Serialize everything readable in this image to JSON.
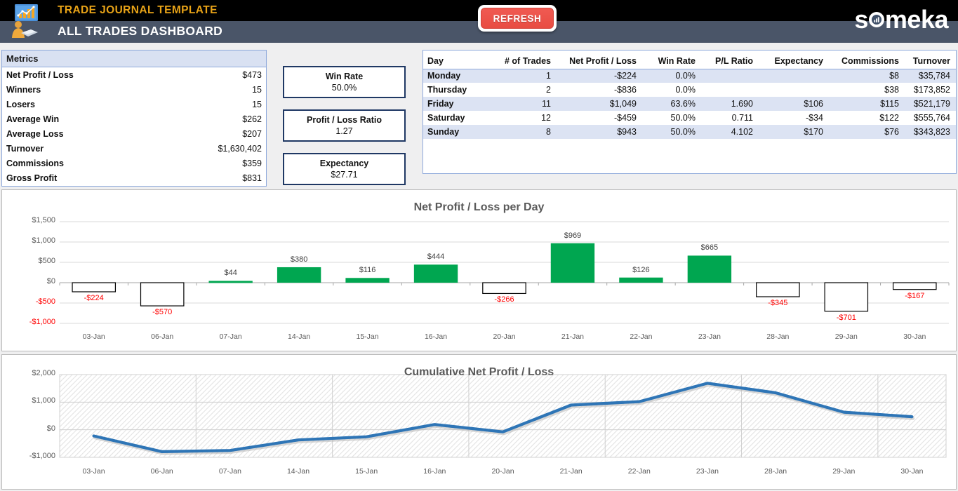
{
  "header": {
    "template_title": "TRADE JOURNAL TEMPLATE",
    "dashboard_title": "ALL TRADES DASHBOARD",
    "refresh_label": "REFRESH",
    "brand": "someka",
    "logo_icon": "trader-chart-icon"
  },
  "metrics": {
    "title": "Metrics",
    "rows": [
      {
        "label": "Net Profit / Loss",
        "value": "$473"
      },
      {
        "label": "Winners",
        "value": "15"
      },
      {
        "label": "Losers",
        "value": "15"
      },
      {
        "label": "Average Win",
        "value": "$262"
      },
      {
        "label": "Average Loss",
        "value": "$207"
      },
      {
        "label": "Turnover",
        "value": "$1,630,402"
      },
      {
        "label": "Commissions",
        "value": "$359"
      },
      {
        "label": "Gross Profit",
        "value": "$831"
      }
    ]
  },
  "kpis": [
    {
      "label": "Win Rate",
      "value": "50.0%"
    },
    {
      "label": "Profit / Loss Ratio",
      "value": "1.27"
    },
    {
      "label": "Expectancy",
      "value": "$27.71"
    }
  ],
  "day_table": {
    "columns": [
      "Day",
      "# of Trades",
      "Net Profit / Loss",
      "Win Rate",
      "P/L Ratio",
      "Expectancy",
      "Commissions",
      "Turnover"
    ],
    "rows": [
      {
        "day": "Monday",
        "trades": "1",
        "net": "-$224",
        "net_negative": true,
        "win_rate": "0.0%",
        "pl_ratio": "",
        "expectancy": "",
        "commissions": "$8",
        "turnover": "$35,784"
      },
      {
        "day": "Thursday",
        "trades": "2",
        "net": "-$836",
        "net_negative": true,
        "win_rate": "0.0%",
        "pl_ratio": "",
        "expectancy": "",
        "commissions": "$38",
        "turnover": "$173,852"
      },
      {
        "day": "Friday",
        "trades": "11",
        "net": "$1,049",
        "net_negative": false,
        "win_rate": "63.6%",
        "pl_ratio": "1.690",
        "expectancy": "$106",
        "commissions": "$115",
        "turnover": "$521,179"
      },
      {
        "day": "Saturday",
        "trades": "12",
        "net": "-$459",
        "net_negative": true,
        "win_rate": "50.0%",
        "pl_ratio": "0.711",
        "expectancy": "-$34",
        "commissions": "$122",
        "turnover": "$555,764"
      },
      {
        "day": "Sunday",
        "trades": "8",
        "net": "$943",
        "net_negative": false,
        "win_rate": "50.0%",
        "pl_ratio": "4.102",
        "expectancy": "$170",
        "commissions": "$76",
        "turnover": "$343,823"
      }
    ]
  },
  "colors": {
    "accent_gold": "#e8a317",
    "header_black": "#000000",
    "header_slate": "#4a5568",
    "refresh_red": "#e84c42",
    "positive_green": "#00a650",
    "negative_red": "#ff0000",
    "line_blue": "#2e75b6",
    "kpi_border": "#1f3864",
    "table_band": "#dce3f3"
  },
  "chart_data": [
    {
      "type": "bar",
      "title": "Net Profit / Loss per Day",
      "xlabel": "",
      "ylabel": "",
      "ylim": [
        -1000,
        1500
      ],
      "yticks": [
        1500,
        1000,
        500,
        0,
        -500,
        -1000
      ],
      "ytick_labels": [
        "$1,500",
        "$1,000",
        "$500",
        "$0",
        "-$500",
        "-$1,000"
      ],
      "grid": true,
      "legend": "none",
      "categories": [
        "03-Jan",
        "06-Jan",
        "07-Jan",
        "14-Jan",
        "15-Jan",
        "16-Jan",
        "20-Jan",
        "21-Jan",
        "22-Jan",
        "23-Jan",
        "28-Jan",
        "29-Jan",
        "30-Jan"
      ],
      "values": [
        -224,
        -570,
        44,
        380,
        116,
        444,
        -266,
        969,
        126,
        665,
        -345,
        -701,
        -167
      ],
      "data_labels": [
        "-$224",
        "-$570",
        "$44",
        "$380",
        "$116",
        "$444",
        "-$266",
        "$969",
        "$126",
        "$665",
        "-$345",
        "-$701",
        "-$167"
      ]
    },
    {
      "type": "line",
      "title": "Cumulative Net Profit / Loss",
      "xlabel": "",
      "ylabel": "",
      "ylim": [
        -1000,
        2000
      ],
      "yticks": [
        2000,
        1000,
        0,
        -1000
      ],
      "ytick_labels": [
        "$2,000",
        "$1,000",
        "$0",
        "-$1,000"
      ],
      "grid": true,
      "legend": "none",
      "categories": [
        "03-Jan",
        "06-Jan",
        "07-Jan",
        "14-Jan",
        "15-Jan",
        "16-Jan",
        "20-Jan",
        "21-Jan",
        "22-Jan",
        "23-Jan",
        "28-Jan",
        "29-Jan",
        "30-Jan"
      ],
      "values": [
        -224,
        -794,
        -750,
        -370,
        -254,
        190,
        -76,
        893,
        1019,
        1684,
        1339,
        638,
        471
      ]
    }
  ]
}
